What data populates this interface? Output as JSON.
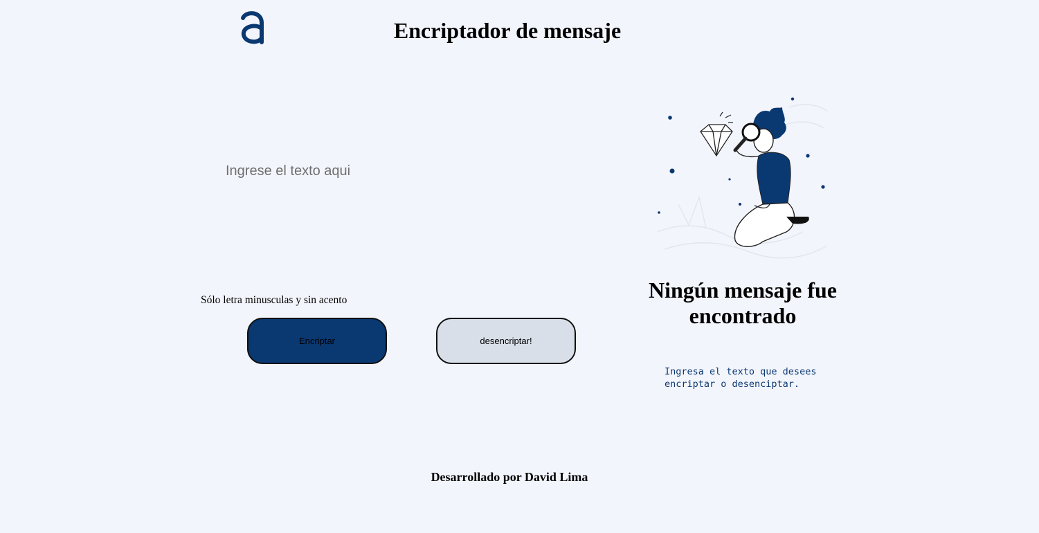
{
  "header": {
    "logo_icon": "alura-logo-icon",
    "title": "Encriptador de mensaje"
  },
  "input": {
    "placeholder": "Ingrese el texto aqui",
    "value": ""
  },
  "hint": "Sólo letra minusculas y sin acento",
  "buttons": {
    "encrypt_label": "Encriptar",
    "decrypt_label": "desencriptar!"
  },
  "output": {
    "illustration_icon": "person-with-magnifying-glass-icon",
    "empty_title": "Ningún mensaje fue encontrado",
    "empty_description": "Ingresa el texto que desees encriptar o desenciptar."
  },
  "footer": {
    "credit": "Desarrollado por David Lima"
  },
  "colors": {
    "background": "#f3f5fc",
    "primary": "#0a3871",
    "secondary_button": "#d8dfe8"
  }
}
